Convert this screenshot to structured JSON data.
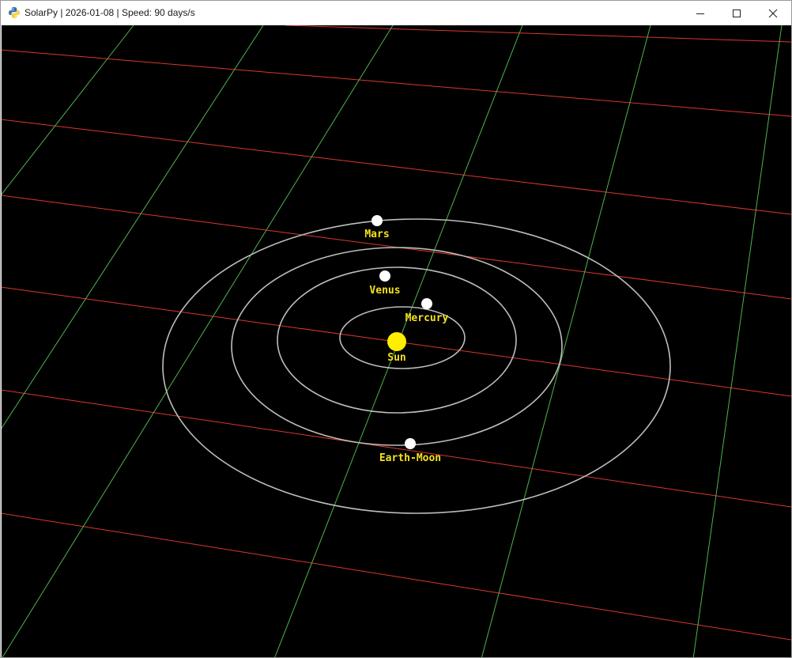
{
  "window": {
    "title": "SolarPy | 2026-01-08 | Speed: 90 days/s",
    "app_icon": "python-snake-icon",
    "controls": [
      "minimize-icon",
      "maximize-icon",
      "close-icon"
    ]
  },
  "scene": {
    "background": "#000000",
    "grid_colors": {
      "x_lines": "#d8382d",
      "z_lines": "#4fb34f"
    },
    "orbit_color": "#bdbdbd",
    "label_color": "#f5e21b",
    "sun_color": "#ffee00",
    "planet_color": "#ffffff",
    "bodies": [
      {
        "name": "Sun"
      },
      {
        "name": "Mercury"
      },
      {
        "name": "Venus"
      },
      {
        "name": "Earth-Moon"
      },
      {
        "name": "Mars"
      }
    ]
  }
}
